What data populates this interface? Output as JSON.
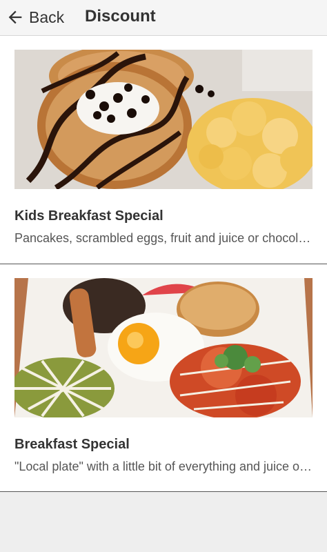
{
  "header": {
    "back_label": "Back",
    "title": "Discount"
  },
  "items": [
    {
      "name": "Kids Breakfast Special",
      "description": "Pancakes, scrambled eggs, fruit and juice or chocolate milk"
    },
    {
      "name": "Breakfast Special",
      "description": "\"Local plate\" with a little bit of everything and juice or coffee"
    }
  ]
}
